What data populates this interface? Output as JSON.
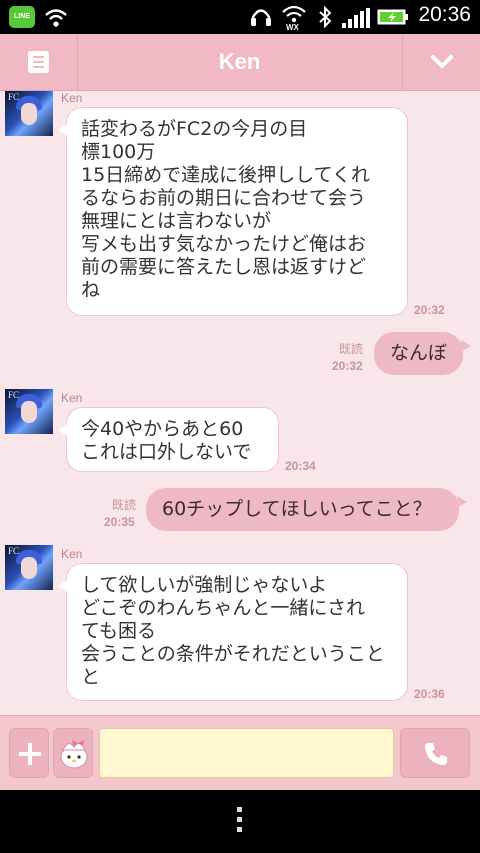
{
  "status_bar": {
    "line_app_badge": "LINE",
    "time": "20:36",
    "icons": [
      "line-icon",
      "wifi-icon",
      "headphones-icon",
      "wifi-wx-icon",
      "bluetooth-icon",
      "signal-icon",
      "battery-charging-icon"
    ]
  },
  "header": {
    "title": "Ken",
    "menu_icon": "list-icon",
    "toggle_icon": "chevron-down-icon"
  },
  "messages": [
    {
      "direction": "in",
      "sender": "Ken",
      "lines": [
        "話変わるがFC2の今月の目",
        "標100万",
        "15日締めで達成に後押ししてくれ",
        "るならお前の期日に合わせて会う",
        "無理にとは言わないが",
        "写メも出す気なかったけど俺はお",
        "前の需要に答えたし恩は返すけど",
        "ね"
      ],
      "time": "20:32"
    },
    {
      "direction": "out",
      "read": "既読",
      "text": "なんぼ",
      "time": "20:32"
    },
    {
      "direction": "in",
      "sender": "Ken",
      "lines": [
        "今40やからあと60",
        "これは口外しないで"
      ],
      "time": "20:34"
    },
    {
      "direction": "out",
      "read": "既読",
      "text": "60チップしてほしいってこと？",
      "time": "20:35"
    },
    {
      "direction": "in",
      "sender": "Ken",
      "lines": [
        "して欲しいが強制じゃないよ",
        "どこぞのわんちゃんと一緒にされ",
        "ても困る",
        "会うことの条件がそれだということ",
        "と"
      ],
      "time": "20:36"
    }
  ],
  "input_bar": {
    "placeholder": "",
    "plus_icon": "plus-icon",
    "sticker_icon": "sticker-icon",
    "call_icon": "phone-icon"
  },
  "nav_bar": {
    "menu_icon": "overflow-menu-icon"
  },
  "colors": {
    "header": "#f0b9c4",
    "background": "#f9e6ea",
    "outgoing_bubble": "#eeb9c4",
    "input_field": "#fff8d2"
  }
}
